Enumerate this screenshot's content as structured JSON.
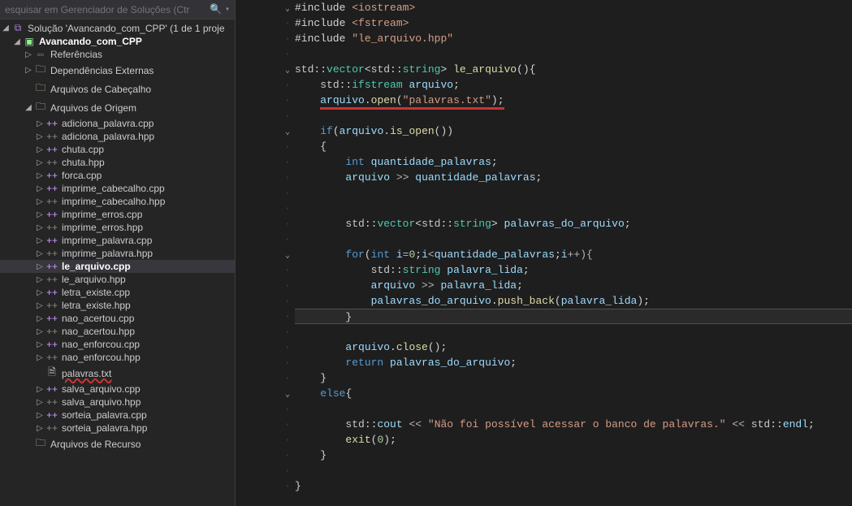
{
  "search": {
    "placeholder": "esquisar em Gerenciador de Soluções (Ctr"
  },
  "tree": {
    "solution": "Solução 'Avancando_com_CPP' (1 de 1 proje",
    "project": "Avancando_com_CPP",
    "references": "Referências",
    "externalDeps": "Dependências Externas",
    "headerFiles": "Arquivos de Cabeçalho",
    "sourceFiles": "Arquivos de Origem",
    "resourceFiles": "Arquivos de Recurso",
    "files": [
      "adiciona_palavra.cpp",
      "adiciona_palavra.hpp",
      "chuta.cpp",
      "chuta.hpp",
      "forca.cpp",
      "imprime_cabecalho.cpp",
      "imprime_cabecalho.hpp",
      "imprime_erros.cpp",
      "imprime_erros.hpp",
      "imprime_palavra.cpp",
      "imprime_palavra.hpp",
      "le_arquivo.cpp",
      "le_arquivo.hpp",
      "letra_existe.cpp",
      "letra_existe.hpp",
      "nao_acertou.cpp",
      "nao_acertou.hpp",
      "nao_enforcou.cpp",
      "nao_enforcou.hpp",
      "palavras.txt",
      "salva_arquivo.cpp",
      "salva_arquivo.hpp",
      "sorteia_palavra.cpp",
      "sorteia_palavra.hpp"
    ]
  },
  "code": {
    "lines": [
      {
        "html": "<span class='c-punct'>#include</span> <span class='c-string'>&lt;iostream&gt;</span>",
        "fold": "v"
      },
      {
        "html": "<span class='c-punct'>#include</span> <span class='c-string'>&lt;fstream&gt;</span>"
      },
      {
        "html": "<span class='c-punct'>#include</span> <span class='c-string'>\"le_arquivo.hpp\"</span>"
      },
      {
        "html": ""
      },
      {
        "html": "<span class='c-namespace'>std</span><span class='c-punct'>::</span><span class='c-class'>vector</span><span class='c-punct'>&lt;</span><span class='c-namespace'>std</span><span class='c-punct'>::</span><span class='c-class'>string</span><span class='c-punct'>&gt;</span> <span class='c-func'>le_arquivo</span><span class='c-punct'>(){</span>",
        "fold": "v"
      },
      {
        "html": "    <span class='c-namespace'>std</span><span class='c-punct'>::</span><span class='c-class'>ifstream</span> <span class='c-var'>arquivo</span><span class='c-punct'>;</span>"
      },
      {
        "html": "    <span class='red-underline-svg'><span class='c-var'>arquivo</span><span class='c-punct'>.</span><span class='c-func'>open</span><span class='c-punct'>(</span><span class='c-string'>\"palavras.txt\"</span><span class='c-punct'>);</span></span>"
      },
      {
        "html": ""
      },
      {
        "html": "    <span class='c-keyword'>if</span><span class='c-punct'>(</span><span class='c-var'>arquivo</span><span class='c-punct'>.</span><span class='c-func'>is_open</span><span class='c-punct'>())</span>",
        "fold": "v"
      },
      {
        "html": "    <span class='c-punct'>{</span>"
      },
      {
        "html": "        <span class='c-keyword'>int</span> <span class='c-var'>quantidade_palavras</span><span class='c-punct'>;</span>"
      },
      {
        "html": "        <span class='c-var'>arquivo</span> <span class='c-op'>&gt;&gt;</span> <span class='c-var'>quantidade_palavras</span><span class='c-punct'>;</span>"
      },
      {
        "html": ""
      },
      {
        "html": ""
      },
      {
        "html": "        <span class='c-namespace'>std</span><span class='c-punct'>::</span><span class='c-class'>vector</span><span class='c-punct'>&lt;</span><span class='c-namespace'>std</span><span class='c-punct'>::</span><span class='c-class'>string</span><span class='c-punct'>&gt;</span> <span class='c-var'>palavras_do_arquivo</span><span class='c-punct'>;</span>"
      },
      {
        "html": ""
      },
      {
        "html": "        <span class='c-keyword'>for</span><span class='c-punct'>(</span><span class='c-keyword'>int</span> <span class='c-var'>i</span><span class='c-op'>=</span><span class='c-number'>0</span><span class='c-punct'>;</span><span class='c-var'>i</span><span class='c-op'>&lt;</span><span class='c-var'>quantidade_palavras</span><span class='c-punct'>;</span><span class='c-var'>i</span><span class='c-op'>++){</span>",
        "fold": "v"
      },
      {
        "html": "            <span class='c-namespace'>std</span><span class='c-punct'>::</span><span class='c-class'>string</span> <span class='c-var'>palavra_lida</span><span class='c-punct'>;</span>"
      },
      {
        "html": "            <span class='c-var'>arquivo</span> <span class='c-op'>&gt;&gt;</span> <span class='c-var'>palavra_lida</span><span class='c-punct'>;</span>"
      },
      {
        "html": "            <span class='c-var'>palavras_do_arquivo</span><span class='c-punct'>.</span><span class='c-func'>push_back</span><span class='c-punct'>(</span><span class='c-var'>palavra_lida</span><span class='c-punct'>);</span>"
      },
      {
        "html": "        <span class='c-punct'>}</span>",
        "highlight": true
      },
      {
        "html": ""
      },
      {
        "html": "        <span class='c-var'>arquivo</span><span class='c-punct'>.</span><span class='c-func'>close</span><span class='c-punct'>();</span>"
      },
      {
        "html": "        <span class='c-keyword'>return</span> <span class='c-var'>palavras_do_arquivo</span><span class='c-punct'>;</span>"
      },
      {
        "html": "    <span class='c-punct'>}</span>"
      },
      {
        "html": "    <span class='c-keyword'>else</span><span class='c-punct'>{</span>",
        "fold": "v"
      },
      {
        "html": ""
      },
      {
        "html": "        <span class='c-namespace'>std</span><span class='c-punct'>::</span><span class='c-var'>cout</span> <span class='c-op'>&lt;&lt;</span> <span class='c-string'>\"Não foi possível acessar o banco de palavras.\"</span> <span class='c-op'>&lt;&lt;</span> <span class='c-namespace'>std</span><span class='c-punct'>::</span><span class='c-var'>endl</span><span class='c-punct'>;</span>"
      },
      {
        "html": "        <span class='c-func'>exit</span><span class='c-punct'>(</span><span class='c-number'>0</span><span class='c-punct'>);</span>"
      },
      {
        "html": "    <span class='c-punct'>}</span>"
      },
      {
        "html": ""
      },
      {
        "html": "<span class='c-punct'>}</span>"
      }
    ]
  }
}
